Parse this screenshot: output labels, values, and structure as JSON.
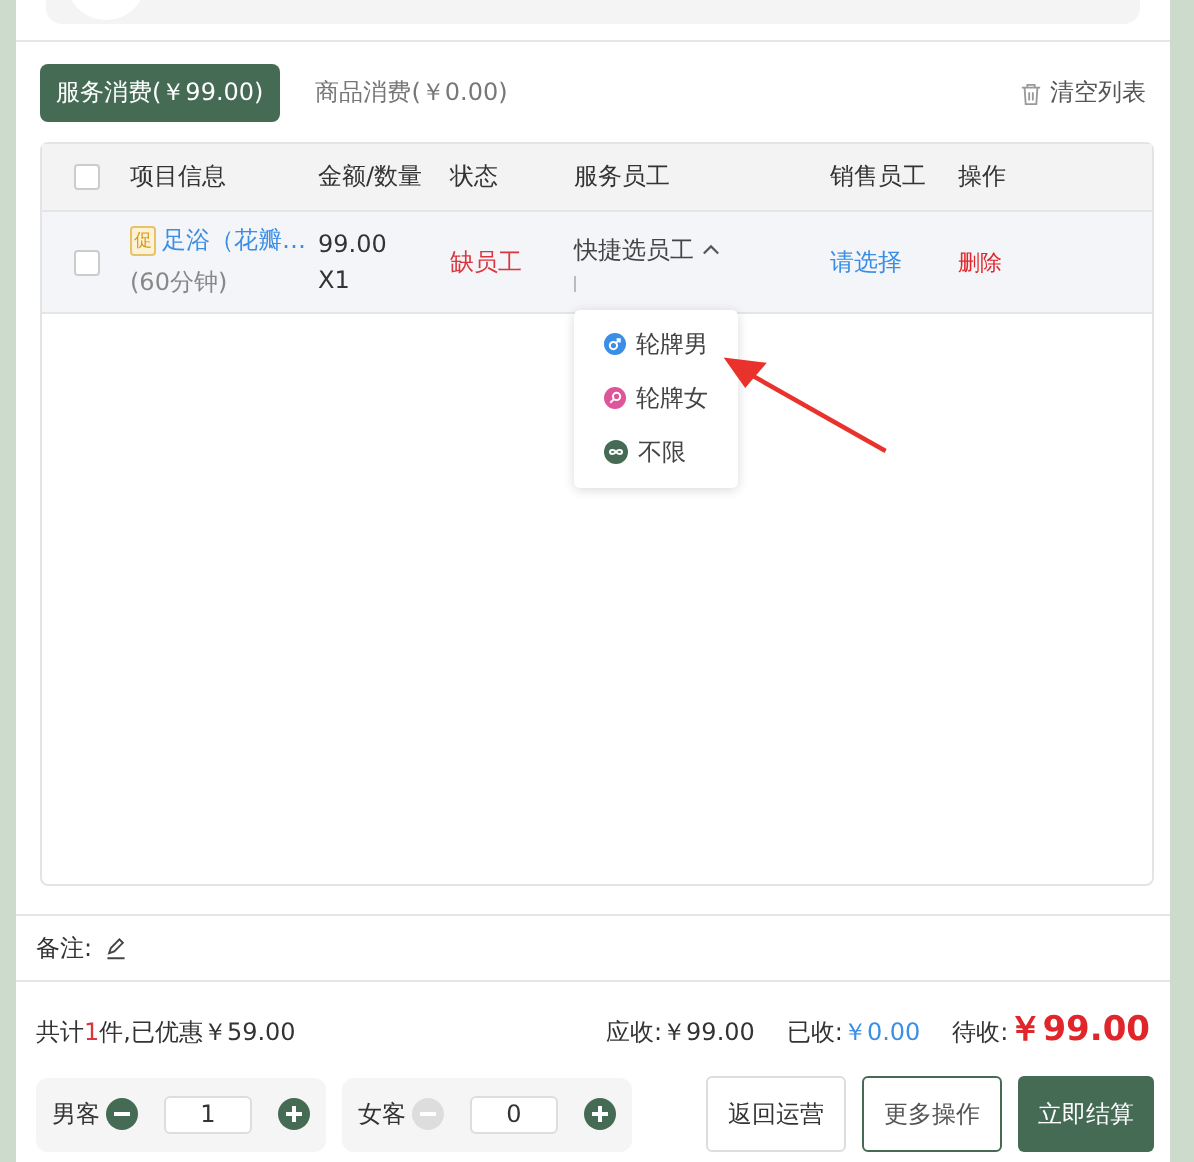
{
  "tabs": [
    {
      "label": "服务消费(￥99.00)",
      "selected": true
    },
    {
      "label": "商品消费(￥0.00)",
      "selected": false
    }
  ],
  "clear_button": "清空列表",
  "table": {
    "all_checked": false,
    "columns": [
      "项目信息",
      "金额/数量",
      "状态",
      "服务员工",
      "销售员工",
      "操作"
    ],
    "rows": [
      {
        "checked": false,
        "badge": "促",
        "name": "足浴（花瓣…",
        "duration": "(60分钟)",
        "price": "99.00",
        "qty": "X1",
        "status": "缺员工",
        "staff": "快捷选员工",
        "staff_expanded": true,
        "sales": "请选择",
        "action": "删除"
      }
    ]
  },
  "dropdown": [
    {
      "kind": "male",
      "label": "轮牌男"
    },
    {
      "kind": "female",
      "label": "轮牌女"
    },
    {
      "kind": "any",
      "label": "不限"
    }
  ],
  "notes_label": "备注:",
  "summary": {
    "count_prefix": "共计",
    "count": "1",
    "count_suffix": "件,已优惠￥59.00",
    "due_label": "应收:",
    "due": "￥99.00",
    "paid_label": "已收:",
    "paid": "￥0.00",
    "pending_label": "待收:",
    "pending": "￥99.00"
  },
  "guests": [
    {
      "label": "男客",
      "value": "1",
      "minus_disabled": false
    },
    {
      "label": "女客",
      "value": "0",
      "minus_disabled": true
    }
  ],
  "buttons": [
    {
      "kind": "plain",
      "label": "返回运营"
    },
    {
      "kind": "outline",
      "label": "更多操作"
    },
    {
      "kind": "primary",
      "label": "立即结算"
    }
  ]
}
